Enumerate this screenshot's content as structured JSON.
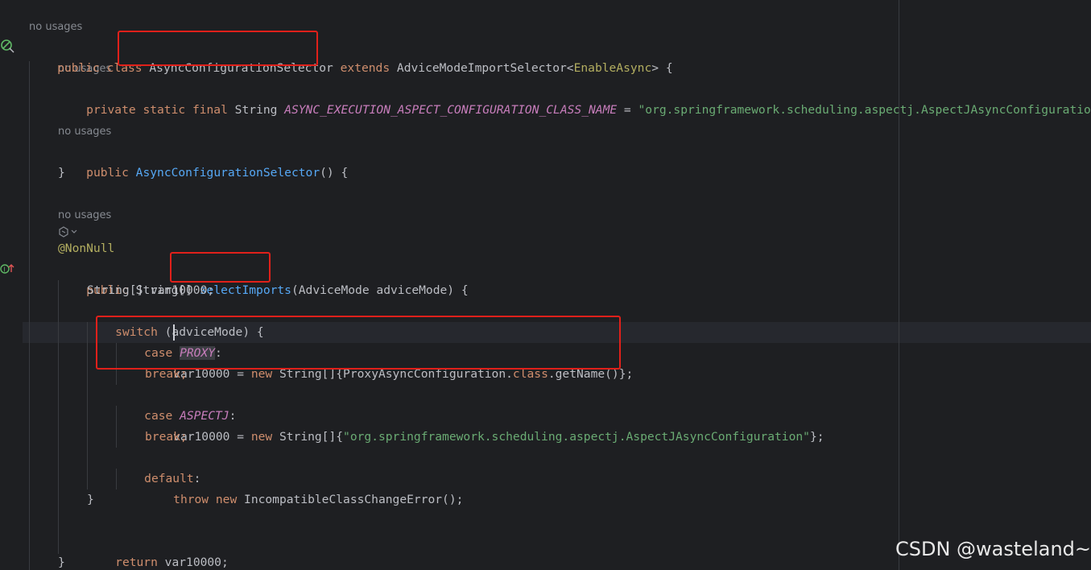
{
  "hints": {
    "no_usages": "no usages"
  },
  "code": {
    "l1": {
      "kw1": "public class ",
      "cls": "AsyncConfigurationSelector",
      "kw2": " extends ",
      "sup": "AdviceModeImportSelector",
      "lt": "<",
      "gen": "EnableAsync",
      "rest": "> {"
    },
    "l2": {
      "kw": "private static final ",
      "type": "String ",
      "const": "ASYNC_EXECUTION_ASPECT_CONFIGURATION_CLASS_NAME",
      "eq": " = ",
      "str": "\"org.springframework.scheduling.aspectj.AspectJAsyncConfiguration"
    },
    "l3": {
      "kw": "public ",
      "fn": "AsyncConfigurationSelector",
      "rest": "() {"
    },
    "l4": "}",
    "l5": "@NonNull",
    "l6": {
      "kw": "public ",
      "type": "String[] ",
      "fn": "selectImports",
      "rest": "(AdviceMode adviceMode) {"
    },
    "l7": "String[] var10000;",
    "l8": {
      "kw": "switch ",
      "rest": "(adviceMode) {"
    },
    "l9": {
      "kw": "case ",
      "const": "PROXY",
      "rest": ":"
    },
    "l10": {
      "a": "var10000 = ",
      "kw": "new ",
      "b": "String[]{ProxyAsyncConfiguration.",
      "kw2": "class",
      "c": ".getName()};"
    },
    "l11": "break;",
    "l12": {
      "kw": "case ",
      "const": "ASPECTJ",
      "rest": ":"
    },
    "l13": {
      "a": "var10000 = ",
      "kw": "new ",
      "b": "String[]{",
      "str": "\"org.springframework.scheduling.aspectj.AspectJAsyncConfiguration\"",
      "c": "};"
    },
    "l14": "break;",
    "l15": {
      "kw": "default",
      "rest": ":"
    },
    "l16": {
      "kw1": "throw ",
      "kw2": "new ",
      "rest": "IncompatibleClassChangeError();"
    },
    "l17": "}",
    "l18": {
      "kw": "return ",
      "rest": "var10000;"
    },
    "l19": "}"
  },
  "icons": {
    "gutter_class": "spring-bean-icon",
    "gutter_method": "implements-method-icon",
    "inlay": "ai-assistant-icon"
  },
  "colors": {
    "background": "#1e1f22",
    "keyword": "#cf8e6d",
    "function": "#56a8f5",
    "string": "#6aab73",
    "constant": "#c77dbb",
    "annotation": "#b3ae60",
    "highlight_box": "#e0201a"
  },
  "watermark": "CSDN @wasteland~"
}
